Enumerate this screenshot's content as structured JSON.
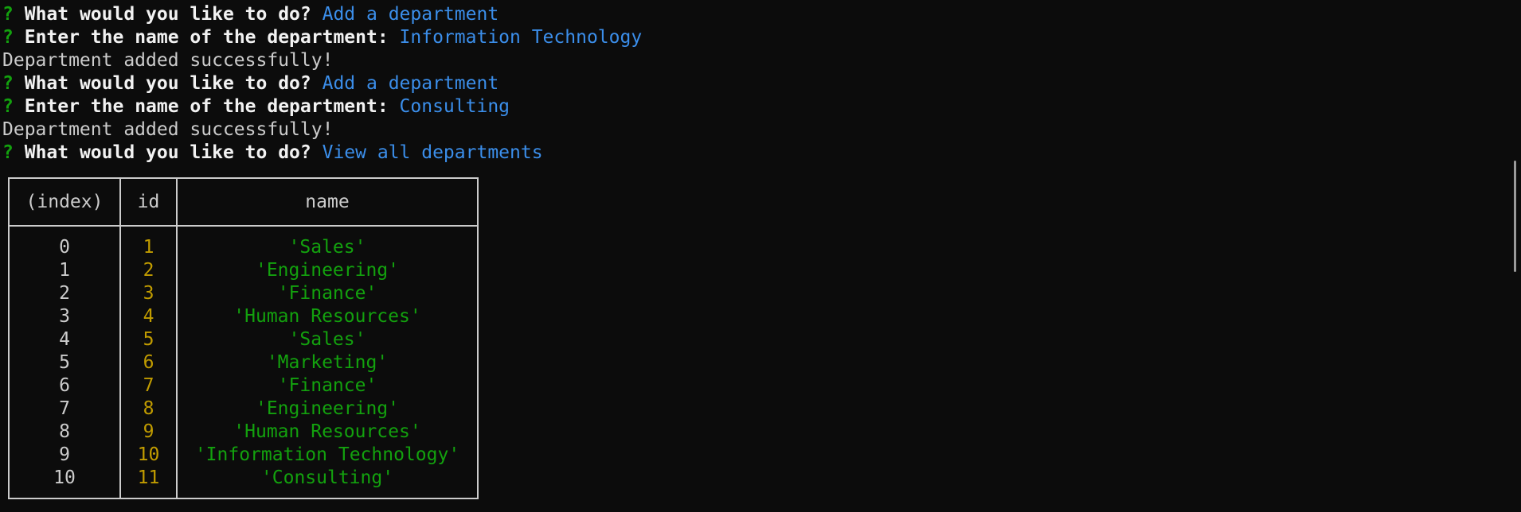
{
  "terminal": {
    "lines": [
      {
        "type": "prompt",
        "qmark": "?",
        "text": "What would you like to do?",
        "answer": "Add a department"
      },
      {
        "type": "prompt",
        "qmark": "?",
        "text": "Enter the name of the department:",
        "answer": "Information Technology"
      },
      {
        "type": "output",
        "text": "Department added successfully!"
      },
      {
        "type": "prompt",
        "qmark": "?",
        "text": "What would you like to do?",
        "answer": "Add a department"
      },
      {
        "type": "prompt",
        "qmark": "?",
        "text": "Enter the name of the department:",
        "answer": "Consulting"
      },
      {
        "type": "output",
        "text": "Department added successfully!"
      },
      {
        "type": "prompt",
        "qmark": "?",
        "text": "What would you like to do?",
        "answer": "View all departments"
      }
    ]
  },
  "table": {
    "headers": [
      "(index)",
      "id",
      "name"
    ],
    "rows": [
      {
        "index": "0",
        "id": "1",
        "name": "'Sales'"
      },
      {
        "index": "1",
        "id": "2",
        "name": "'Engineering'"
      },
      {
        "index": "2",
        "id": "3",
        "name": "'Finance'"
      },
      {
        "index": "3",
        "id": "4",
        "name": "'Human Resources'"
      },
      {
        "index": "4",
        "id": "5",
        "name": "'Sales'"
      },
      {
        "index": "5",
        "id": "6",
        "name": "'Marketing'"
      },
      {
        "index": "6",
        "id": "7",
        "name": "'Finance'"
      },
      {
        "index": "7",
        "id": "8",
        "name": "'Engineering'"
      },
      {
        "index": "8",
        "id": "9",
        "name": "'Human Resources'"
      },
      {
        "index": "9",
        "id": "10",
        "name": "'Information Technology'"
      },
      {
        "index": "10",
        "id": "11",
        "name": "'Consulting'"
      }
    ]
  },
  "colors": {
    "background": "#0c0c0c",
    "question_mark": "#13a10e",
    "answer": "#3b8eea",
    "number": "#c19c00",
    "string": "#13a10e",
    "text": "#cccccc"
  }
}
